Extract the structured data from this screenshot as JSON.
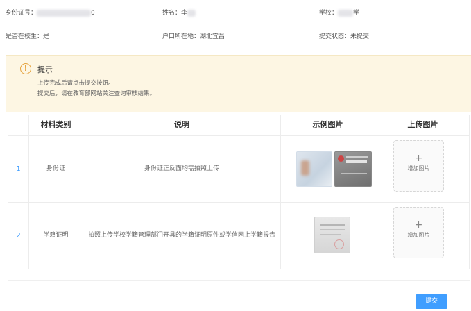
{
  "info": {
    "id_label": "身份证号：",
    "id_tail": "0",
    "name_label": "姓名：",
    "name_value": "李",
    "school_label": "学校：",
    "school_tail": "学",
    "enrolled_label": "是否在校生：",
    "enrolled_value": "是",
    "hukou_label": "户口所在地：",
    "hukou_value": "湖北宜昌",
    "status_label": "提交状态：",
    "status_value": "未提交"
  },
  "notice": {
    "title": "提示",
    "lines": [
      "上传完成后请点击提交按钮。",
      "提交后，请在教育部网站关注查询审核结果。"
    ]
  },
  "table": {
    "headers": [
      "",
      "材料类别",
      "说明",
      "示例图片",
      "上传图片"
    ],
    "rows": [
      {
        "index": "1",
        "category": "身份证",
        "description": "身份证正反面均需拍照上传",
        "upload_label": "增加图片"
      },
      {
        "index": "2",
        "category": "学籍证明",
        "description": "拍照上传学校学籍管理部门开具的学籍证明原件或学信网上学籍报告",
        "upload_label": "增加图片"
      }
    ]
  },
  "upload_plus": "+",
  "submit_label": "提交",
  "colors": {
    "accent": "#409eff",
    "warning": "#e6a23c",
    "notice_bg": "#fdf6e3"
  }
}
